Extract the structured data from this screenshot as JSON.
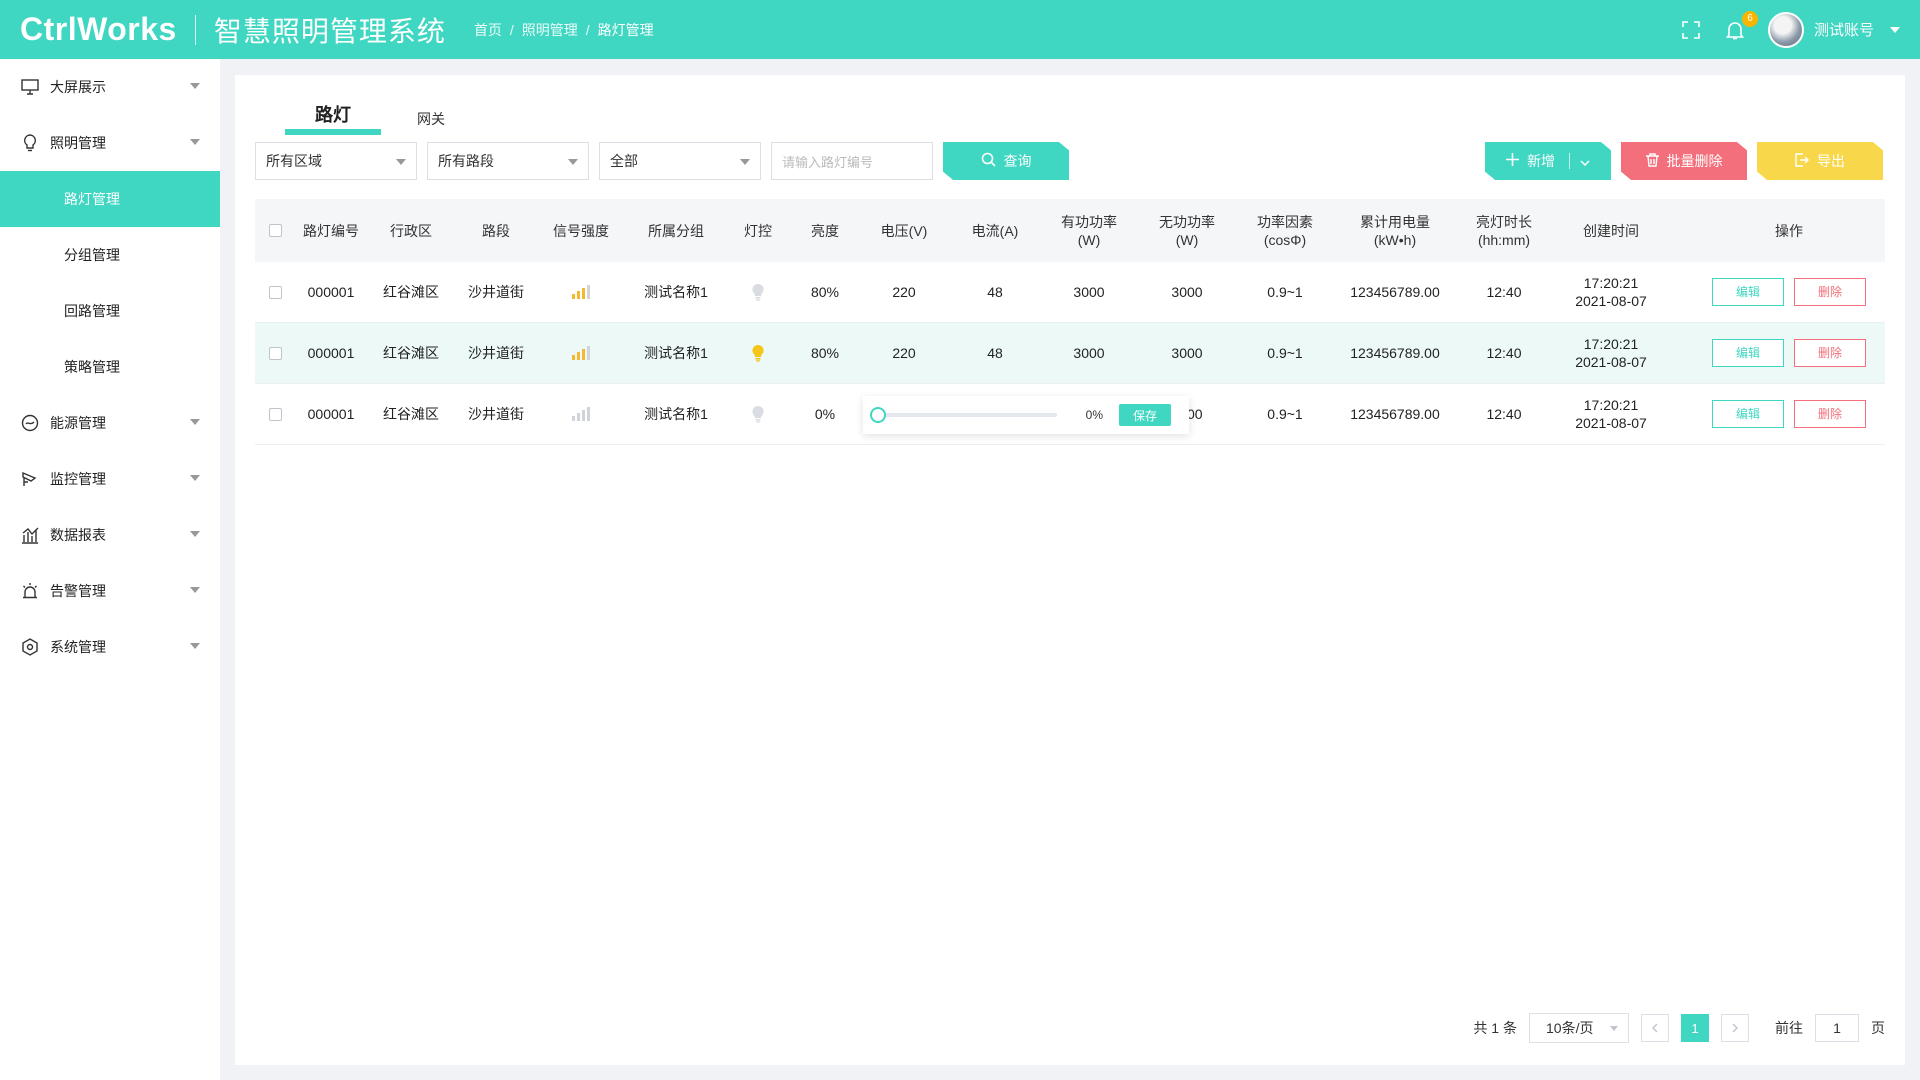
{
  "header": {
    "logo": "CtrlWorks",
    "title": "智慧照明管理系统",
    "breadcrumb": [
      "首页",
      "照明管理",
      "路灯管理"
    ],
    "badge_count": "6",
    "username": "测试账号"
  },
  "sidebar": {
    "items": [
      {
        "label": "大屏展示",
        "icon": "monitor-icon"
      },
      {
        "label": "照明管理",
        "icon": "bulb-icon"
      },
      {
        "label": "能源管理",
        "icon": "energy-icon"
      },
      {
        "label": "监控管理",
        "icon": "camera-icon"
      },
      {
        "label": "数据报表",
        "icon": "chart-icon"
      },
      {
        "label": "告警管理",
        "icon": "alarm-icon"
      },
      {
        "label": "系统管理",
        "icon": "settings-icon"
      }
    ],
    "sub_items": [
      "路灯管理",
      "分组管理",
      "回路管理",
      "策略管理"
    ]
  },
  "tabs": [
    "路灯",
    "网关"
  ],
  "filters": {
    "area": "所有区域",
    "road": "所有路段",
    "status": "全部",
    "search_placeholder": "请输入路灯编号",
    "query_label": "查询"
  },
  "actions": {
    "add": "新增",
    "batch_delete": "批量删除",
    "export": "导出"
  },
  "table": {
    "headers": [
      "路灯编号",
      "行政区",
      "路段",
      "信号强度",
      "所属分组",
      "灯控",
      "亮度",
      "电压(V)",
      "电流(A)",
      "有功功率\n(W)",
      "无功功率\n(W)",
      "功率因素\n(cosΦ)",
      "累计用电量\n(kW•h)",
      "亮灯时长\n(hh:mm)",
      "创建时间",
      "操作"
    ],
    "rows": [
      {
        "id": "000001",
        "district": "红谷滩区",
        "road": "沙井道街",
        "signal": 3,
        "group": "测试名称1",
        "lamp_on": false,
        "brightness": "80%",
        "voltage": "220",
        "current": "48",
        "active_power": "3000",
        "reactive_power": "3000",
        "power_factor": "0.9~1",
        "energy": "123456789.00",
        "duration": "12:40",
        "time": "17:20:21",
        "date": "2021-08-07"
      },
      {
        "id": "000001",
        "district": "红谷滩区",
        "road": "沙井道街",
        "signal": 3,
        "group": "测试名称1",
        "lamp_on": true,
        "brightness": "80%",
        "voltage": "220",
        "current": "48",
        "active_power": "3000",
        "reactive_power": "3000",
        "power_factor": "0.9~1",
        "energy": "123456789.00",
        "duration": "12:40",
        "time": "17:20:21",
        "date": "2021-08-07"
      },
      {
        "id": "000001",
        "district": "红谷滩区",
        "road": "沙井道街",
        "signal": 0,
        "group": "测试名称1",
        "lamp_on": false,
        "brightness": "0%",
        "voltage": "",
        "current": "",
        "active_power": "",
        "reactive_power": "3000",
        "power_factor": "0.9~1",
        "energy": "123456789.00",
        "duration": "12:40",
        "time": "17:20:21",
        "date": "2021-08-07"
      }
    ],
    "edit_label": "编辑",
    "delete_label": "删除"
  },
  "slider": {
    "value_text": "0%",
    "level": 0,
    "save_label": "保存"
  },
  "pagination": {
    "total": "共 1 条",
    "page_size": "10条/页",
    "current_page": "1",
    "goto_prefix": "前往",
    "goto_value": "1",
    "goto_suffix": "页"
  },
  "colors": {
    "primary": "#3fd6c2",
    "danger": "#f26f7b",
    "warning": "#f8d84a",
    "signal_on": "#f5b82e",
    "signal_off": "#d0d3d9"
  }
}
